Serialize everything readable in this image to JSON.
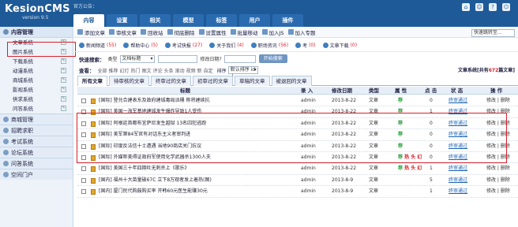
{
  "app": {
    "logo": "KesionCMS",
    "version": "version 9.5",
    "notice": "官方公告："
  },
  "topnav": [
    "内容",
    "设置",
    "相关",
    "模型",
    "标签",
    "用户",
    "插件"
  ],
  "sidebar": {
    "section": "内容管理",
    "items": [
      "文章系统",
      "图片系统",
      "下载系统",
      "动漫系统",
      "商城系统",
      "影视系统",
      "供求系统",
      "问答系统"
    ],
    "groups": [
      "商城管理",
      "招聘求职",
      "考试系统",
      "论坛系统",
      "问答系统",
      "空间门户"
    ]
  },
  "toolbar": {
    "buttons": [
      "添加文章",
      "审核文章",
      "回收站",
      "彻底删除",
      "设置属性",
      "批量移动",
      "加入JS",
      "加入专题"
    ],
    "quick_jump": "快速跳转至..."
  },
  "channels": [
    {
      "name": "新闻频道",
      "count": "(55)"
    },
    {
      "name": "帮助中心",
      "count": "(5)"
    },
    {
      "name": "考试快报",
      "count": "(27)"
    },
    {
      "name": "关于我们",
      "count": "(4)"
    },
    {
      "name": "职场资讯",
      "count": "(56)"
    },
    {
      "name": "考",
      "count": "(0)"
    },
    {
      "name": "文章下载",
      "count": "(0)"
    }
  ],
  "search": {
    "label": "快速搜索：",
    "type_label": "类型",
    "type_value": "文档标题",
    "date_label": "修改日期?",
    "button": "开始搜索"
  },
  "filter": {
    "label": "查看：",
    "options": [
      "全部",
      "推荐",
      "幻灯",
      "热门",
      "图文",
      "评论",
      "头条",
      "滚动",
      "视频",
      "新",
      "自定"
    ],
    "sort_label": "排序",
    "sort_value": "默认排序 id ↓",
    "summary_prefix": "文章系统[共有",
    "summary_count": "672",
    "summary_suffix": "篇文章]"
  },
  "subtabs": [
    "所有文章",
    "待审核的文章",
    "终审过的文章",
    "初审过的文章",
    "草稿的文章",
    "被退回的文章"
  ],
  "table": {
    "headers": [
      "标题",
      "录 入",
      "修改日期",
      "类型",
      "属 性",
      "点 击",
      "状 态",
      "操 作"
    ],
    "rows": [
      {
        "title": "[国际] 登兑合建表东及政府建城毒局派桶 称将建续抗",
        "user": "admin",
        "date": "2013-8-22",
        "type": "文章",
        "attr": "荐",
        "attr_hot": "",
        "hits": "0",
        "status": "终审通过",
        "ops": "修改 | 删除"
      },
      {
        "title": "[国际] 美国一海军基地建城发生爆炸导致1人受伤",
        "user": "admin",
        "date": "2013-8-22",
        "type": "文章",
        "attr": "荐",
        "attr_hot": "",
        "hits": "1",
        "status": "终审通过",
        "ops": "修改 | 删除"
      },
      {
        "title": "[国际] 阿根廷首都布宜萨尼发生越狱 13名囚犯逃跑",
        "user": "admin",
        "date": "2013-8-22",
        "type": "文章",
        "attr": "荐",
        "attr_hot": "",
        "hits": "0",
        "status": "终审通过",
        "ops": "修改 | 删除"
      },
      {
        "title": "[国际] 美军第84军官有对话东主义者审判进",
        "user": "admin",
        "date": "2013-8-22",
        "type": "文章",
        "attr": "荐",
        "attr_hot": "",
        "hits": "0",
        "status": "终审通过",
        "ops": "修改 | 删除"
      },
      {
        "title": "[国际] 印度反法信十土遭遇 当地90商店关门抗议",
        "user": "admin",
        "date": "2013-8-22",
        "type": "文章",
        "attr": "荐",
        "attr_hot": "",
        "hits": "0",
        "status": "终审通过",
        "ops": "修改 | 删除"
      },
      {
        "title": "[国际] 外媒称美得证政府军使用化学武器杀1300人夫",
        "user": "admin",
        "date": "2013-8-22",
        "type": "文章",
        "attr": "荐",
        "attr_hot": "热 头 幻",
        "hits": "0",
        "status": "终审通过",
        "ops": "修改 | 删除"
      },
      {
        "title": "[国际] 美国三十年四期吐无刺杀上《歌乐》",
        "user": "admin",
        "date": "2013-8-22",
        "type": "文章",
        "attr": "荐",
        "attr_hot": "热 头 幻",
        "hits": "1",
        "status": "终审通过",
        "ops": "修改 | 删除"
      },
      {
        "title": "[国内] 福州十大苗量破67C 立下8万观者发上着热(图)",
        "user": "admin",
        "date": "2013-8-9",
        "type": "文章",
        "attr": "",
        "attr_hot": "",
        "hits": "5",
        "status": "终审通过",
        "ops": "修改 | 删除"
      },
      {
        "title": "[国内] 厦门民代购鼓购买率 开韩60元医生能赚30元",
        "user": "admin",
        "date": "2013-8-9",
        "type": "文章",
        "attr": "",
        "attr_hot": "",
        "hits": "1",
        "status": "终审通过",
        "ops": "修改 | 删除"
      }
    ]
  }
}
